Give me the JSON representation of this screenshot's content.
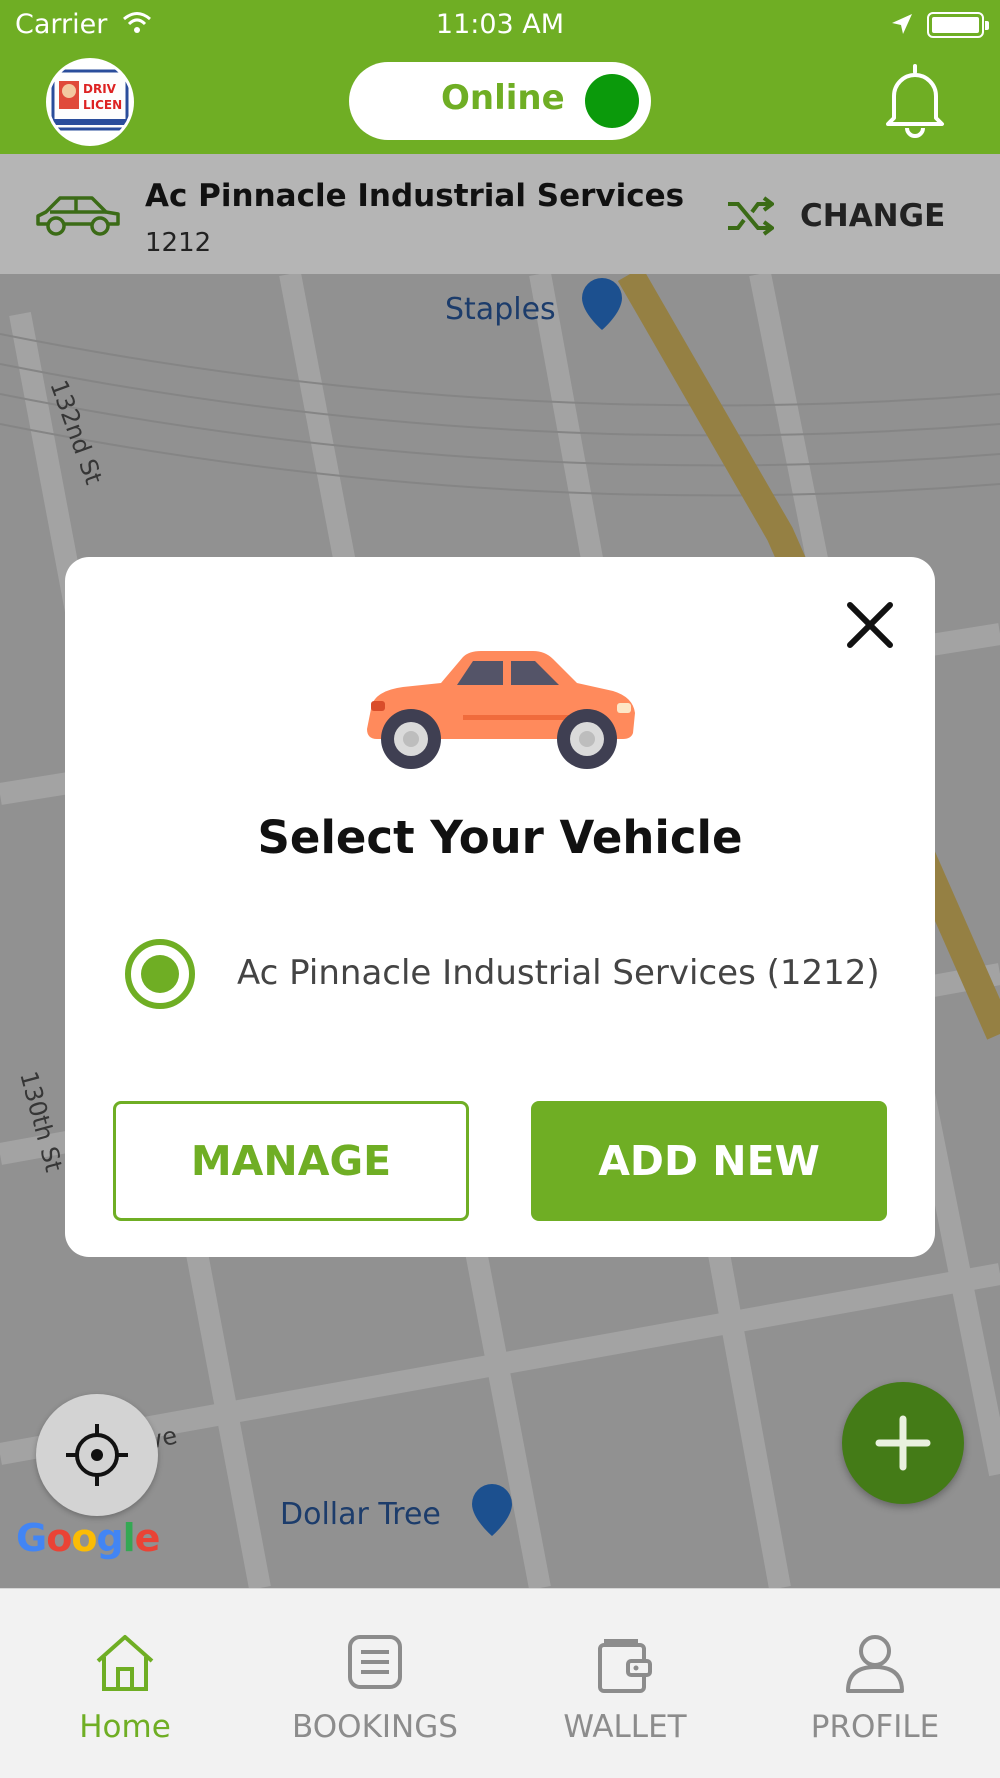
{
  "status_bar": {
    "carrier": "Carrier",
    "time": "11:03 AM"
  },
  "header": {
    "avatar_lettering": "DRIV LICEN",
    "online_label": "Online",
    "online": true,
    "accent_color": "#6fae24"
  },
  "vehicle_bar": {
    "name": "Ac  Pinnacle Industrial Services",
    "number": "1212",
    "change_label": "CHANGE"
  },
  "map": {
    "labels": {
      "staples": "Staples",
      "st_132": "132nd St",
      "st_130": "130th St",
      "ave_fragment": "ve",
      "dollar_tree": "Dollar Tree"
    },
    "google_logo": "Google"
  },
  "modal": {
    "title": "Select Your Vehicle",
    "option_label": "Ac  Pinnacle Industrial Services  (1212)",
    "option_selected": true,
    "manage_label": "MANAGE",
    "add_new_label": "ADD NEW"
  },
  "bottom_nav": {
    "items": [
      {
        "label": "Home",
        "icon": "home-icon",
        "active": true
      },
      {
        "label": "BOOKINGS",
        "icon": "bookings-icon",
        "active": false
      },
      {
        "label": "WALLET",
        "icon": "wallet-icon",
        "active": false
      },
      {
        "label": "PROFILE",
        "icon": "profile-icon",
        "active": false
      }
    ]
  }
}
